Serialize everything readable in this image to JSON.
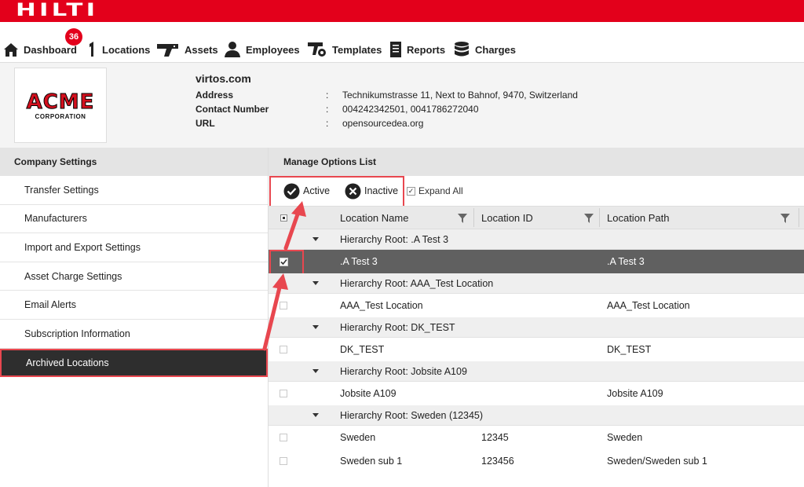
{
  "brand": {
    "logo": "HILTI",
    "color": "#e3001b"
  },
  "nav": {
    "badge": "36",
    "items": [
      {
        "label": "Dashboard",
        "icon": "home-icon"
      },
      {
        "label": "Locations",
        "icon": "location-icon"
      },
      {
        "label": "Assets",
        "icon": "tool-icon"
      },
      {
        "label": "Employees",
        "icon": "person-icon"
      },
      {
        "label": "Templates",
        "icon": "template-icon"
      },
      {
        "label": "Reports",
        "icon": "report-icon"
      },
      {
        "label": "Charges",
        "icon": "database-icon"
      }
    ]
  },
  "company": {
    "logo_top": "ACME",
    "logo_bottom": "CORPORATION",
    "name": "virtos.com",
    "address_label": "Address",
    "address": "Technikumstrasse 11, Next to Bahnof, 9470, Switzerland",
    "contact_label": "Contact Number",
    "contact": "004242342501, 0041786272040",
    "url_label": "URL",
    "url": "opensourcedea.org",
    "colon": ":"
  },
  "sidebar": {
    "title": "Company Settings",
    "items": [
      {
        "label": "Transfer Settings"
      },
      {
        "label": "Manufacturers"
      },
      {
        "label": "Import and Export Settings"
      },
      {
        "label": "Asset Charge Settings"
      },
      {
        "label": "Email Alerts"
      },
      {
        "label": "Subscription Information"
      },
      {
        "label": "Archived Locations",
        "active": true
      }
    ]
  },
  "main": {
    "title": "Manage Options List",
    "active_label": "Active",
    "inactive_label": "Inactive",
    "expand_label": "Expand All",
    "columns": {
      "name": "Location Name",
      "id": "Location ID",
      "path": "Location Path"
    },
    "groups": [
      {
        "label": "Hierarchy Root: .A Test 3",
        "rows": [
          {
            "name": ".A Test 3",
            "id": "",
            "path": ".A Test 3",
            "selected": true
          }
        ]
      },
      {
        "label": "Hierarchy Root: AAA_Test Location",
        "rows": [
          {
            "name": "AAA_Test Location",
            "id": "",
            "path": "AAA_Test Location"
          }
        ]
      },
      {
        "label": "Hierarchy Root: DK_TEST",
        "rows": [
          {
            "name": "DK_TEST",
            "id": "",
            "path": "DK_TEST"
          }
        ]
      },
      {
        "label": "Hierarchy Root: Jobsite A109",
        "rows": [
          {
            "name": "Jobsite A109",
            "id": "",
            "path": "Jobsite A109"
          }
        ]
      },
      {
        "label": "Hierarchy Root: Sweden (12345)",
        "rows": [
          {
            "name": "Sweden",
            "id": "12345",
            "path": "Sweden"
          },
          {
            "name": "Sweden sub 1",
            "id": "123456",
            "path": "Sweden/Sweden sub 1"
          }
        ]
      }
    ]
  },
  "highlight_color": "#e8474f"
}
